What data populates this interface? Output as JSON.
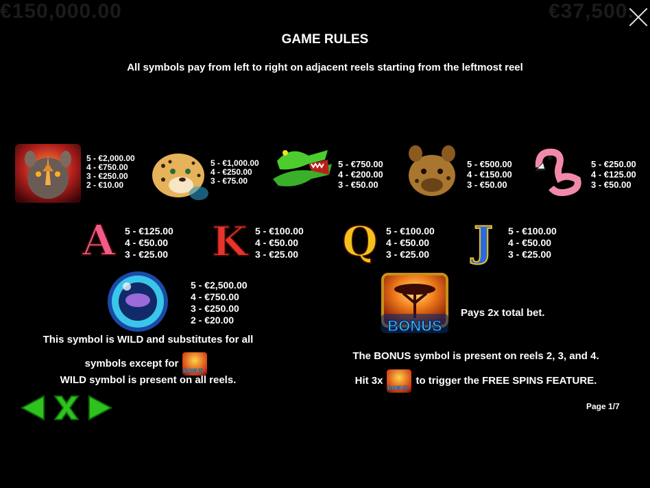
{
  "header": {
    "title": "GAME RULES",
    "subtitle": "All symbols pay from left to right on adjacent reels starting from the leftmost reel"
  },
  "background_text": {
    "left": "€150,000.00",
    "right": "€37,500."
  },
  "symbols": {
    "rhino": {
      "icon": "rhino-icon",
      "pays": [
        "5 - €2,000.00",
        "4 - €750.00",
        "3 - €250.00",
        "2 - €10.00"
      ]
    },
    "cheetah": {
      "icon": "cheetah-icon",
      "pays": [
        "5 - €1,000.00",
        "4 - €250.00",
        "3 - €75.00"
      ]
    },
    "crocodile": {
      "icon": "crocodile-icon",
      "pays": [
        "5 - €750.00",
        "4 - €200.00",
        "3 - €50.00"
      ]
    },
    "hyena": {
      "icon": "hyena-icon",
      "pays": [
        "5 - €500.00",
        "4 - €150.00",
        "3 - €50.00"
      ]
    },
    "flamingo": {
      "icon": "flamingo-icon",
      "pays": [
        "5 - €250.00",
        "4 - €125.00",
        "3 - €50.00"
      ]
    },
    "ace": {
      "letter": "A",
      "pays": [
        "5 - €125.00",
        "4 - €50.00",
        "3 - €25.00"
      ]
    },
    "king": {
      "letter": "K",
      "pays": [
        "5 - €100.00",
        "4 - €50.00",
        "3 - €25.00"
      ]
    },
    "queen": {
      "letter": "Q",
      "pays": [
        "5 - €100.00",
        "4 - €50.00",
        "3 - €25.00"
      ]
    },
    "jack": {
      "letter": "J",
      "pays": [
        "5 - €100.00",
        "4 - €50.00",
        "3 - €25.00"
      ]
    },
    "wild": {
      "icon": "wild-coin-icon",
      "pays": [
        "5 - €2,500.00",
        "4 - €750.00",
        "3 - €250.00",
        "2 - €20.00"
      ]
    },
    "bonus": {
      "icon": "bonus-tree-icon",
      "label": "BONUS",
      "pays": "Pays 2x total bet."
    }
  },
  "wild_text": {
    "line1": "This symbol is WILD and substitutes for all",
    "line2": "symbols except for",
    "line3": "WILD symbol is present on all reels."
  },
  "bonus_text": {
    "line1": "The BONUS symbol is present on reels 2, 3, and 4.",
    "line2_pre": "Hit 3x",
    "line2_post": "to trigger the FREE SPINS FEATURE."
  },
  "nav": {
    "prev_icon": "arrow-left-icon",
    "close_icon": "close-x-icon",
    "next_icon": "arrow-right-icon"
  },
  "pagination": {
    "label": "Page 1/7"
  },
  "colors": {
    "background": "#000000",
    "text": "#ffffff",
    "nav_green": "#2fc21f",
    "close": "#e6e6e6"
  }
}
